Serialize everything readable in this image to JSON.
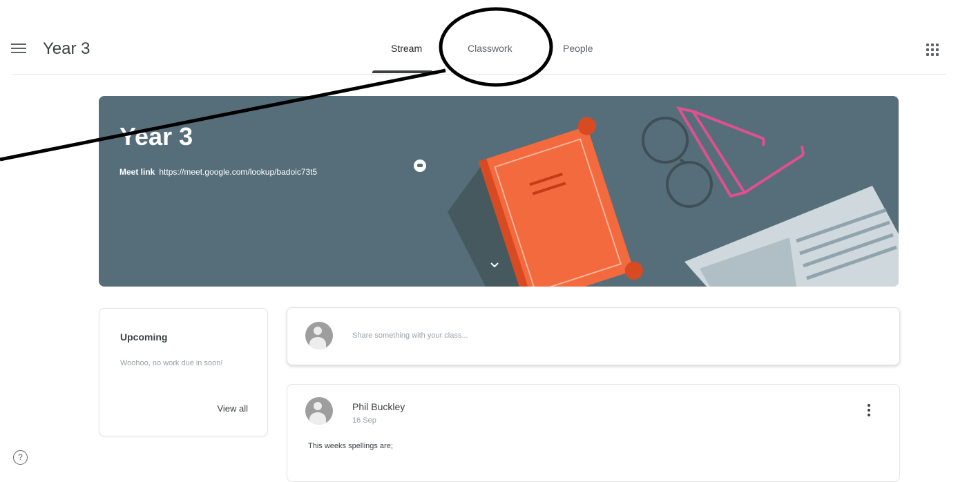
{
  "header": {
    "class_name": "Year 3",
    "tabs": [
      {
        "label": "Stream",
        "active": true
      },
      {
        "label": "Classwork",
        "active": false
      },
      {
        "label": "People",
        "active": false
      }
    ]
  },
  "banner": {
    "title": "Year 3",
    "meet_label": "Meet link",
    "meet_url": "https://meet.google.com/lookup/badoic73t5",
    "color": "#566e7a"
  },
  "upcoming": {
    "title": "Upcoming",
    "text": "Woohoo, no work due in soon!",
    "view_all": "View all"
  },
  "share": {
    "placeholder": "Share something with your class..."
  },
  "post": {
    "author": "Phil Buckley",
    "date": "16 Sep",
    "text": "This weeks spellings are;"
  },
  "help": {
    "glyph": "?"
  },
  "icons": [
    "menu-icon",
    "apps-icon",
    "meet-icon",
    "expand-icon",
    "help-icon",
    "more-vert-icon",
    "avatar"
  ],
  "annotation_color": "#000000"
}
